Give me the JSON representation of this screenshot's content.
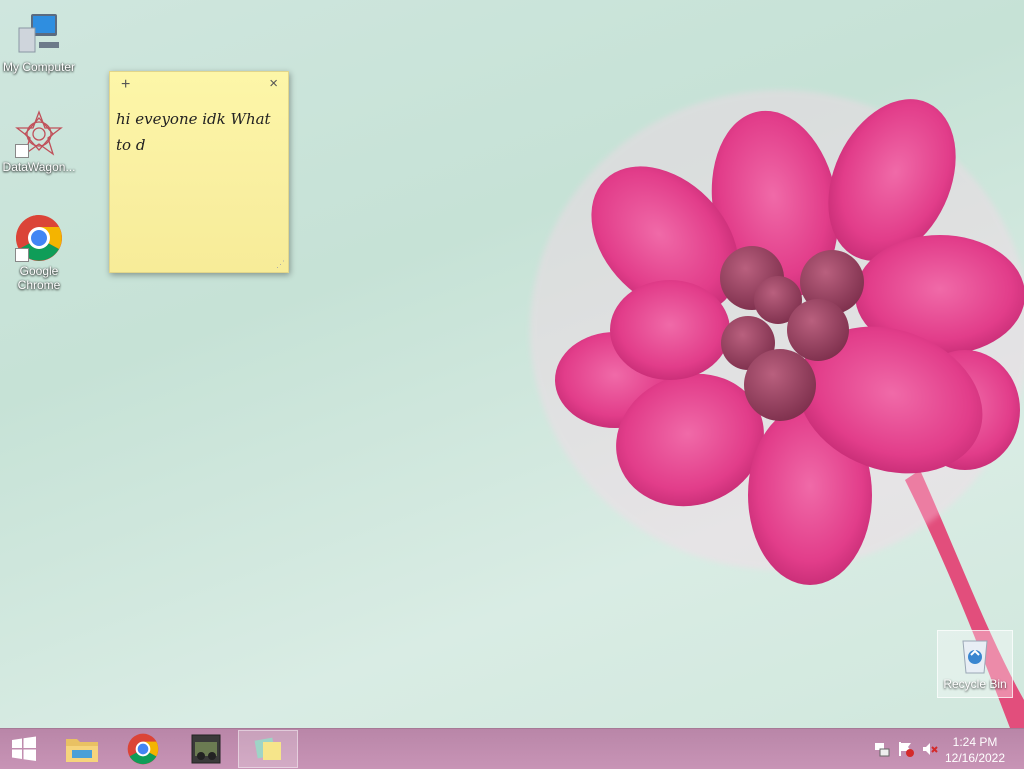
{
  "desktop": {
    "icons": [
      {
        "label": "My Computer"
      },
      {
        "label": "DataWagon..."
      },
      {
        "label": "Google Chrome"
      }
    ],
    "recycle_bin": {
      "label": "Recycle Bin"
    }
  },
  "sticky_note": {
    "add_glyph": "+",
    "close_glyph": "×",
    "text": "hi eveyone idk What to d",
    "color": "#fdf6a8"
  },
  "taskbar": {
    "color": "#c08cae",
    "pinned": [
      "start-button",
      "file-explorer",
      "google-chrome",
      "photo-app",
      "sticky-notes"
    ],
    "active": "sticky-notes"
  },
  "clock": {
    "time": "1:24 PM",
    "date": "12/16/2022"
  }
}
